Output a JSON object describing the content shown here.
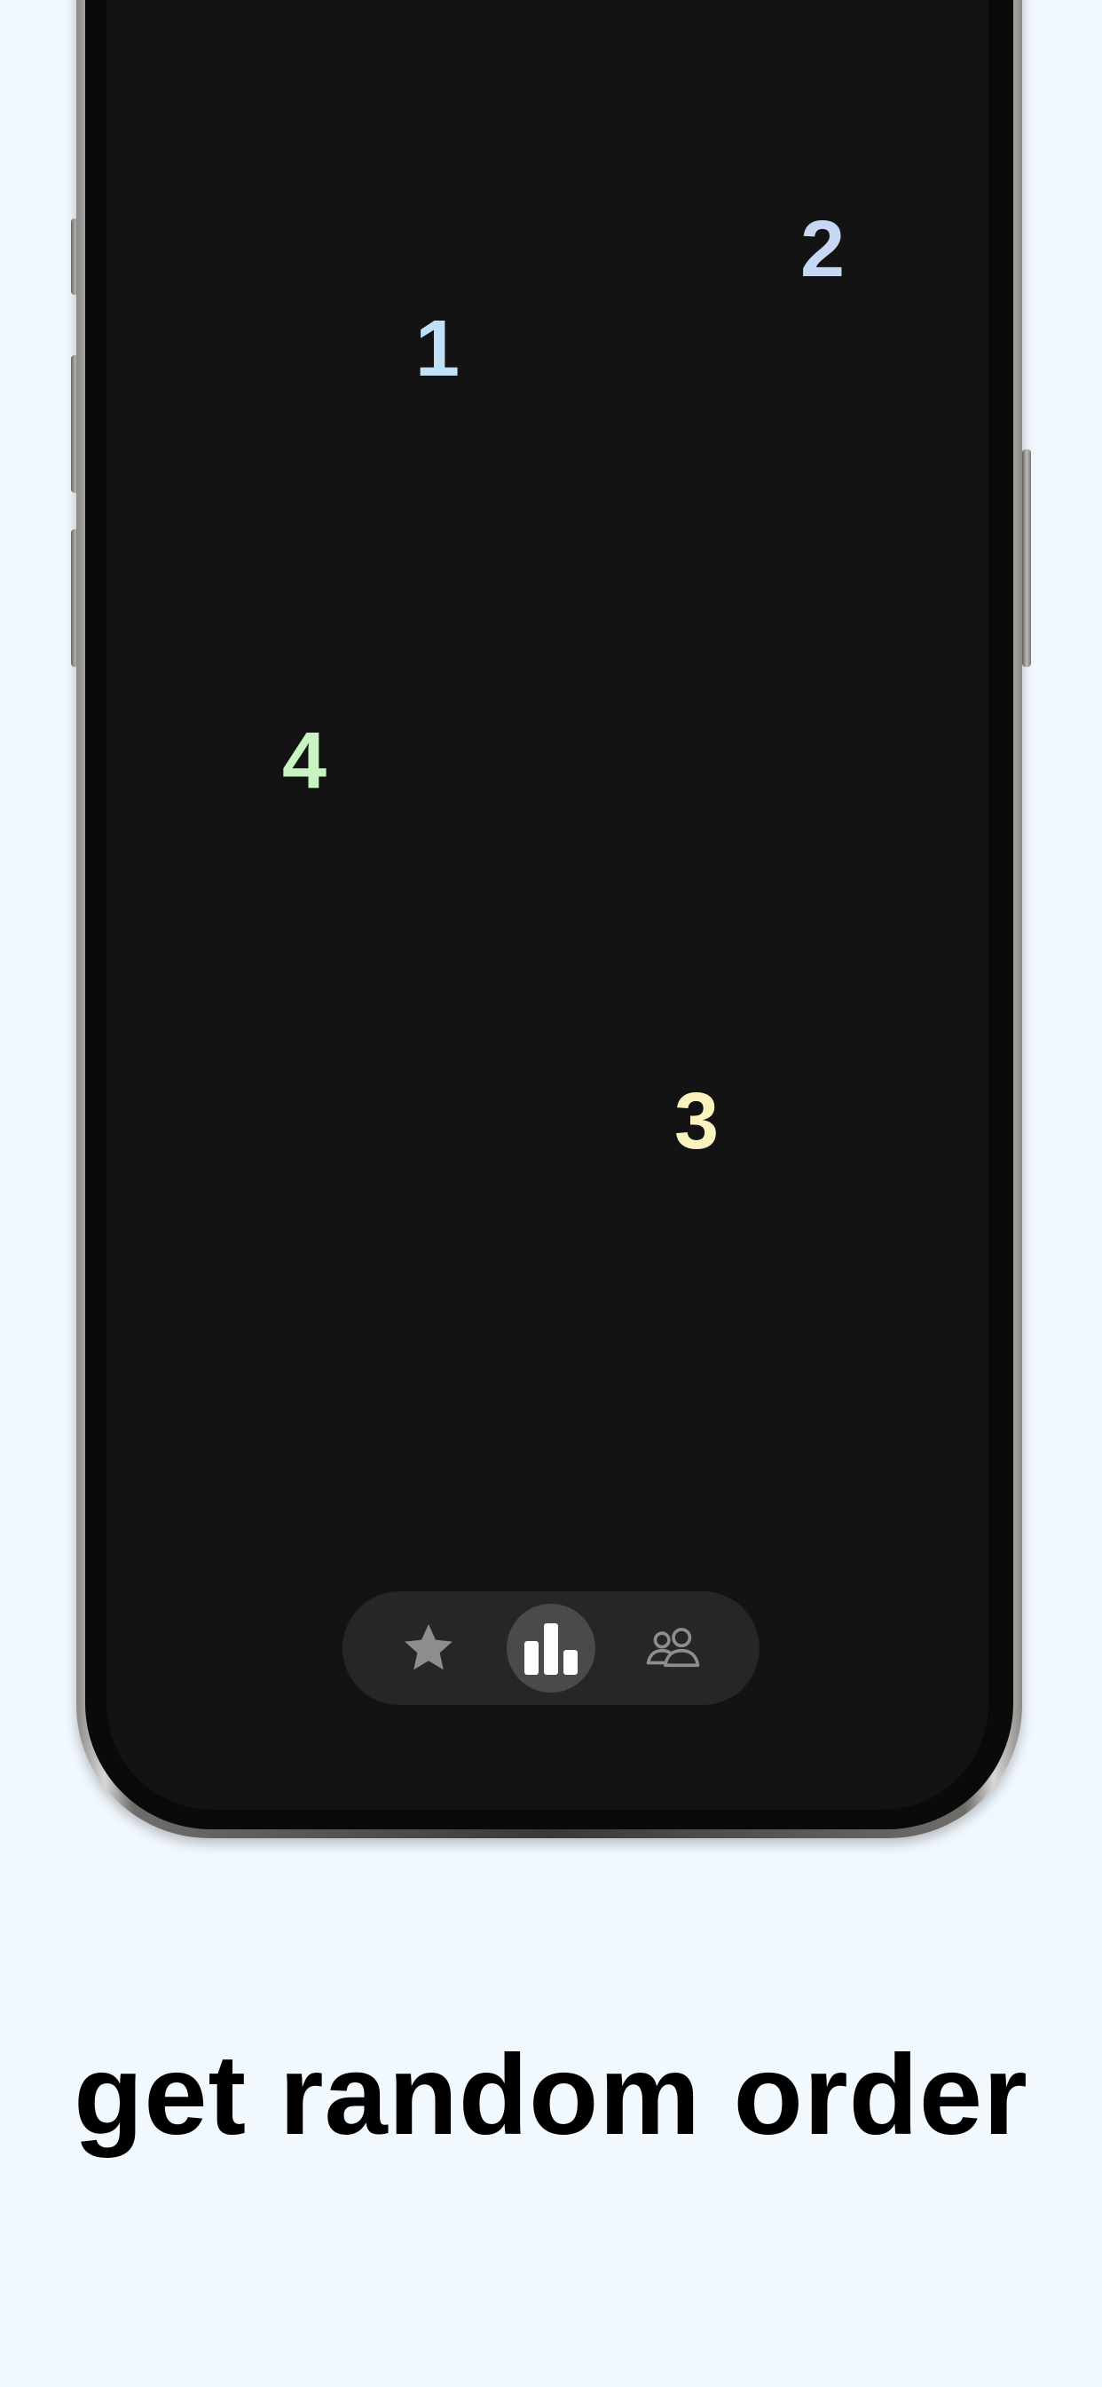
{
  "numbers": [
    {
      "label": "1",
      "color": "#bfe0f6"
    },
    {
      "label": "2",
      "color": "#c6d8f4"
    },
    {
      "label": "3",
      "color": "#fbf3bd"
    },
    {
      "label": "4",
      "color": "#c9f3c2"
    }
  ],
  "tabbar": {
    "items": [
      {
        "icon": "star-icon",
        "selected": false
      },
      {
        "icon": "bar-chart-icon",
        "selected": true
      },
      {
        "icon": "people-icon",
        "selected": false
      }
    ]
  },
  "caption": "get random order",
  "colors": {
    "background": "#f1f8fe",
    "screen": "#131313",
    "tabbar": "#262626",
    "tab_selected": "#4a4a4a"
  }
}
